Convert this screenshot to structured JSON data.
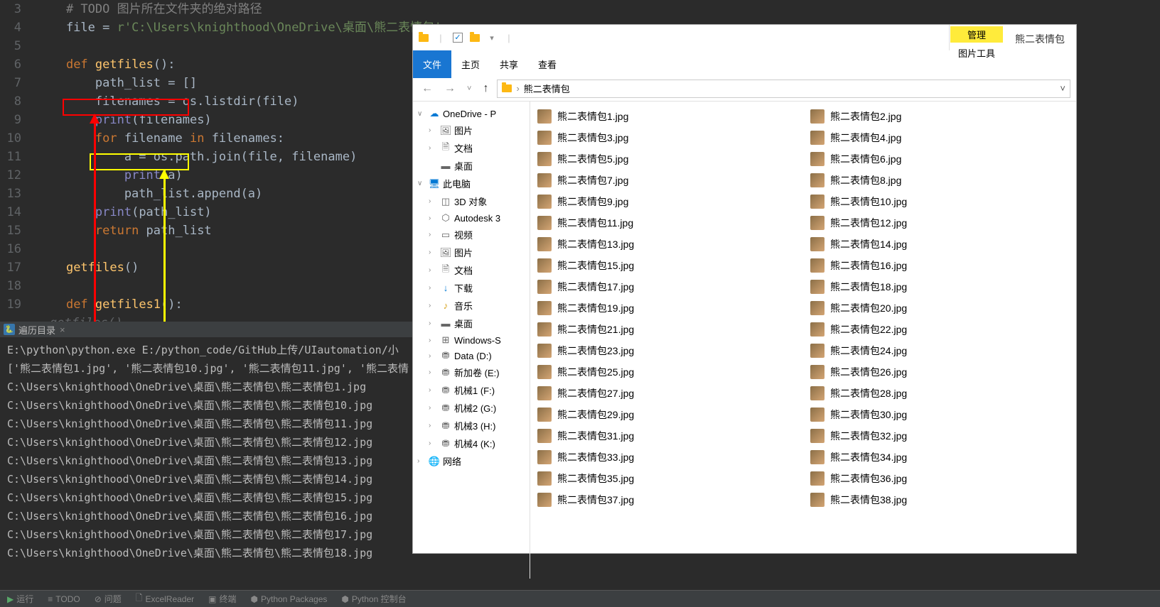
{
  "editor": {
    "lines": [
      {
        "n": 3,
        "html": "    <span class='comment'># TODO 图片所在文件夹的绝对路径</span>"
      },
      {
        "n": 4,
        "html": "    file = <span class='str'>r'C:\\Users\\knighthood\\OneDrive\\桌面\\熊二表情包'</span>"
      },
      {
        "n": 5,
        "html": ""
      },
      {
        "n": 6,
        "html": "    <span class='kw'>def</span> <span class='fn'>getfiles</span>():"
      },
      {
        "n": 7,
        "html": "        path_list = []"
      },
      {
        "n": 8,
        "html": "        filenames = os.listdir(file)"
      },
      {
        "n": 9,
        "html": "        <span class='builtin'>print</span>(filenames)"
      },
      {
        "n": 10,
        "html": "        <span class='kw'>for</span> filename <span class='kw'>in</span> filenames:"
      },
      {
        "n": 11,
        "html": "            a = os.path.join(file, filename)"
      },
      {
        "n": 12,
        "html": "            <span class='builtin'>print</span>(a)"
      },
      {
        "n": 13,
        "html": "            path_list.append(a)"
      },
      {
        "n": 14,
        "html": "        <span class='builtin'>print</span>(path_list)"
      },
      {
        "n": 15,
        "html": "        <span class='kw'>return</span> path_list"
      },
      {
        "n": 16,
        "html": ""
      },
      {
        "n": 17,
        "html": "    <span class='fn'>getfiles</span>()"
      },
      {
        "n": 18,
        "html": ""
      },
      {
        "n": 19,
        "html": "    <span class='kw'>def</span> <span class='fn'>getfiles1</span>():"
      }
    ],
    "hint": "getfiles()"
  },
  "tab": {
    "name": "遍历目录",
    "close": "×"
  },
  "console": {
    "lines": [
      "E:\\python\\python.exe E:/python_code/GitHub上传/UIautomation/小",
      "['熊二表情包1.jpg', '熊二表情包10.jpg', '熊二表情包11.jpg', '熊二表情",
      "C:\\Users\\knighthood\\OneDrive\\桌面\\熊二表情包\\熊二表情包1.jpg",
      "C:\\Users\\knighthood\\OneDrive\\桌面\\熊二表情包\\熊二表情包10.jpg",
      "C:\\Users\\knighthood\\OneDrive\\桌面\\熊二表情包\\熊二表情包11.jpg",
      "C:\\Users\\knighthood\\OneDrive\\桌面\\熊二表情包\\熊二表情包12.jpg",
      "C:\\Users\\knighthood\\OneDrive\\桌面\\熊二表情包\\熊二表情包13.jpg",
      "C:\\Users\\knighthood\\OneDrive\\桌面\\熊二表情包\\熊二表情包14.jpg",
      "C:\\Users\\knighthood\\OneDrive\\桌面\\熊二表情包\\熊二表情包15.jpg",
      "C:\\Users\\knighthood\\OneDrive\\桌面\\熊二表情包\\熊二表情包16.jpg",
      "C:\\Users\\knighthood\\OneDrive\\桌面\\熊二表情包\\熊二表情包17.jpg",
      "C:\\Users\\knighthood\\OneDrive\\桌面\\熊二表情包\\熊二表情包18.jpg"
    ]
  },
  "status": {
    "run": "运行",
    "todo": "TODO",
    "problems": "问题",
    "excel": "ExcelReader",
    "terminal": "终端",
    "packages": "Python Packages",
    "pyconsole": "Python 控制台"
  },
  "explorer": {
    "title": "熊二表情包",
    "ribbon": {
      "file": "文件",
      "home": "主页",
      "share": "共享",
      "view": "查看",
      "manage": "管理",
      "pictools": "图片工具"
    },
    "breadcrumb": {
      "folder": "熊二表情包",
      "sep": "›"
    },
    "tree": [
      {
        "toggle": "∨",
        "icon": "cloud",
        "label": "OneDrive - P"
      },
      {
        "toggle": "›",
        "icon": "pic",
        "label": "图片",
        "indent": 1
      },
      {
        "toggle": "›",
        "icon": "doc",
        "label": "文档",
        "indent": 1
      },
      {
        "toggle": "",
        "icon": "desktop",
        "label": "桌面",
        "indent": 1
      },
      {
        "toggle": "∨",
        "icon": "pc",
        "label": "此电脑"
      },
      {
        "toggle": "›",
        "icon": "3d",
        "label": "3D 对象",
        "indent": 1
      },
      {
        "toggle": "›",
        "icon": "auto",
        "label": "Autodesk 3",
        "indent": 1
      },
      {
        "toggle": "›",
        "icon": "video",
        "label": "视频",
        "indent": 1
      },
      {
        "toggle": "›",
        "icon": "pic",
        "label": "图片",
        "indent": 1
      },
      {
        "toggle": "›",
        "icon": "doc",
        "label": "文档",
        "indent": 1
      },
      {
        "toggle": "›",
        "icon": "download",
        "label": "下载",
        "indent": 1
      },
      {
        "toggle": "›",
        "icon": "music",
        "label": "音乐",
        "indent": 1
      },
      {
        "toggle": "›",
        "icon": "desktop",
        "label": "桌面",
        "indent": 1
      },
      {
        "toggle": "›",
        "icon": "win",
        "label": "Windows-S",
        "indent": 1
      },
      {
        "toggle": "›",
        "icon": "drive",
        "label": "Data (D:)",
        "indent": 1
      },
      {
        "toggle": "›",
        "icon": "drive",
        "label": "新加卷 (E:)",
        "indent": 1
      },
      {
        "toggle": "›",
        "icon": "drive",
        "label": "机械1 (F:)",
        "indent": 1
      },
      {
        "toggle": "›",
        "icon": "drive",
        "label": "机械2 (G:)",
        "indent": 1
      },
      {
        "toggle": "›",
        "icon": "drive",
        "label": "机械3 (H:)",
        "indent": 1
      },
      {
        "toggle": "›",
        "icon": "drive",
        "label": "机械4 (K:)",
        "indent": 1
      },
      {
        "toggle": "›",
        "icon": "net",
        "label": "网络"
      }
    ],
    "files_left": [
      "熊二表情包1.jpg",
      "熊二表情包3.jpg",
      "熊二表情包5.jpg",
      "熊二表情包7.jpg",
      "熊二表情包9.jpg",
      "熊二表情包11.jpg",
      "熊二表情包13.jpg",
      "熊二表情包15.jpg",
      "熊二表情包17.jpg",
      "熊二表情包19.jpg",
      "熊二表情包21.jpg",
      "熊二表情包23.jpg",
      "熊二表情包25.jpg",
      "熊二表情包27.jpg",
      "熊二表情包29.jpg",
      "熊二表情包31.jpg",
      "熊二表情包33.jpg",
      "熊二表情包35.jpg",
      "熊二表情包37.jpg"
    ],
    "files_right": [
      "熊二表情包2.jpg",
      "熊二表情包4.jpg",
      "熊二表情包6.jpg",
      "熊二表情包8.jpg",
      "熊二表情包10.jpg",
      "熊二表情包12.jpg",
      "熊二表情包14.jpg",
      "熊二表情包16.jpg",
      "熊二表情包18.jpg",
      "熊二表情包20.jpg",
      "熊二表情包22.jpg",
      "熊二表情包24.jpg",
      "熊二表情包26.jpg",
      "熊二表情包28.jpg",
      "熊二表情包30.jpg",
      "熊二表情包32.jpg",
      "熊二表情包34.jpg",
      "熊二表情包36.jpg",
      "熊二表情包38.jpg"
    ]
  }
}
